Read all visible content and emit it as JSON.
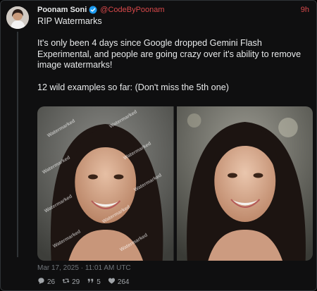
{
  "post": {
    "author": "Poonam Soni",
    "handle": "@CodeByPoonam",
    "time": "9h",
    "line1": "RIP Watermarks",
    "line2": "It's only been 4 days since Google dropped Gemini Flash Experimental, and people are going crazy over it's ability to remove image watermarks!",
    "line3": "12 wild examples so far: (Don't miss the 5th one)",
    "timestamp": "Mar 17, 2025 · 11:01 AM UTC"
  },
  "media": {
    "watermark_text": "Watermarked"
  },
  "stats": {
    "replies": "26",
    "retweets": "29",
    "quotes": "5",
    "likes": "264"
  },
  "icons": {
    "verified": "verified-badge-icon",
    "reply": "comment-icon",
    "retweet": "retweet-icon",
    "quote": "quote-icon",
    "like": "heart-icon"
  },
  "colors": {
    "accent": "#d9494b",
    "verified": "#1d9bf0",
    "background": "#0f0f10"
  }
}
